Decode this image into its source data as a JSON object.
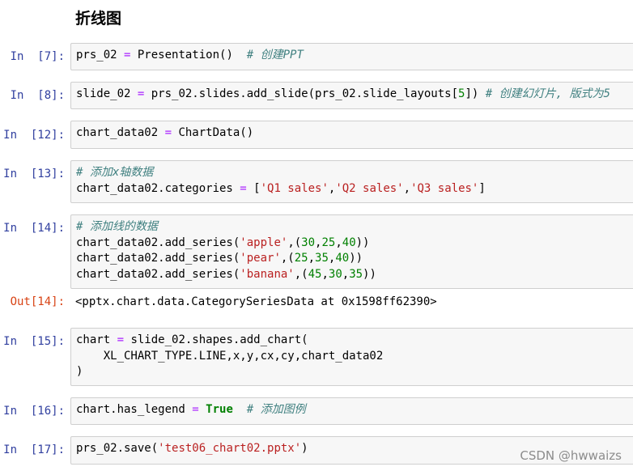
{
  "heading": "折线图",
  "cells": [
    {
      "prompt": "In  [7]:",
      "lines": [
        [
          [
            "n",
            "prs_02 "
          ],
          [
            "o",
            "="
          ],
          [
            "n",
            " Presentation()  "
          ],
          [
            "c",
            "# 创建PPT"
          ]
        ]
      ]
    },
    {
      "prompt": "In  [8]:",
      "lines": [
        [
          [
            "n",
            "slide_02 "
          ],
          [
            "o",
            "="
          ],
          [
            "n",
            " prs_02.slides.add_slide(prs_02.slide_layouts["
          ],
          [
            "m",
            "5"
          ],
          [
            "n",
            "]) "
          ],
          [
            "c",
            "# 创建幻灯片, 版式为5"
          ]
        ]
      ]
    },
    {
      "prompt": "In  [12]:",
      "lines": [
        [
          [
            "n",
            "chart_data02 "
          ],
          [
            "o",
            "="
          ],
          [
            "n",
            " ChartData()"
          ]
        ]
      ]
    },
    {
      "prompt": "In  [13]:",
      "lines": [
        [
          [
            "c",
            "# 添加x轴数据"
          ]
        ],
        [
          [
            "n",
            "chart_data02.categories "
          ],
          [
            "o",
            "="
          ],
          [
            "n",
            " ["
          ],
          [
            "s",
            "'Q1 sales'"
          ],
          [
            "n",
            ","
          ],
          [
            "s",
            "'Q2 sales'"
          ],
          [
            "n",
            ","
          ],
          [
            "s",
            "'Q3 sales'"
          ],
          [
            "n",
            "]"
          ]
        ]
      ]
    },
    {
      "prompt": "In  [14]:",
      "lines": [
        [
          [
            "c",
            "# 添加线的数据"
          ]
        ],
        [
          [
            "n",
            "chart_data02.add_series("
          ],
          [
            "s",
            "'apple'"
          ],
          [
            "n",
            ",("
          ],
          [
            "m",
            "30"
          ],
          [
            "n",
            ","
          ],
          [
            "m",
            "25"
          ],
          [
            "n",
            ","
          ],
          [
            "m",
            "40"
          ],
          [
            "n",
            "))"
          ]
        ],
        [
          [
            "n",
            "chart_data02.add_series("
          ],
          [
            "s",
            "'pear'"
          ],
          [
            "n",
            ",("
          ],
          [
            "m",
            "25"
          ],
          [
            "n",
            ","
          ],
          [
            "m",
            "35"
          ],
          [
            "n",
            ","
          ],
          [
            "m",
            "40"
          ],
          [
            "n",
            "))"
          ]
        ],
        [
          [
            "n",
            "chart_data02.add_series("
          ],
          [
            "s",
            "'banana'"
          ],
          [
            "n",
            ",("
          ],
          [
            "m",
            "45"
          ],
          [
            "n",
            ","
          ],
          [
            "m",
            "30"
          ],
          [
            "n",
            ","
          ],
          [
            "m",
            "35"
          ],
          [
            "n",
            "))"
          ]
        ]
      ],
      "output_prompt": "Out[14]:",
      "output": "<pptx.chart.data.CategorySeriesData at 0x1598ff62390>"
    },
    {
      "prompt": "In  [15]:",
      "lines": [
        [
          [
            "n",
            "chart "
          ],
          [
            "o",
            "="
          ],
          [
            "n",
            " slide_02.shapes.add_chart("
          ]
        ],
        [
          [
            "n",
            "    XL_CHART_TYPE.LINE,x,y,cx,cy,chart_data02"
          ]
        ],
        [
          [
            "n",
            ")"
          ]
        ]
      ]
    },
    {
      "prompt": "In  [16]:",
      "lines": [
        [
          [
            "n",
            "chart.has_legend "
          ],
          [
            "o",
            "="
          ],
          [
            "n",
            " "
          ],
          [
            "k",
            "True"
          ],
          [
            "n",
            "  "
          ],
          [
            "c",
            "# 添加图例"
          ]
        ]
      ]
    },
    {
      "prompt": "In  [17]:",
      "lines": [
        [
          [
            "n",
            "prs_02.save("
          ],
          [
            "s",
            "'test06_chart02.pptx'"
          ],
          [
            "n",
            ")"
          ]
        ]
      ]
    }
  ],
  "watermark": "CSDN @hwwaizs"
}
